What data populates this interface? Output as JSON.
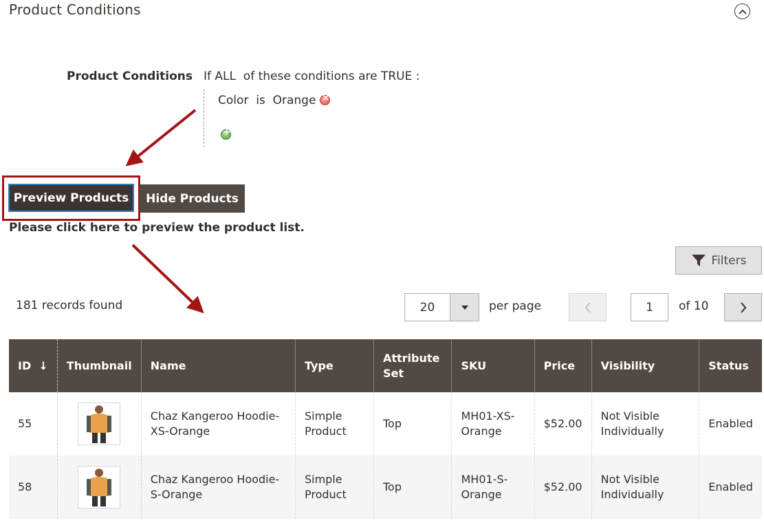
{
  "section": {
    "title": "Product Conditions"
  },
  "conditions": {
    "label": "Product Conditions",
    "rule": {
      "prefix": "If",
      "aggregator": "ALL",
      "middle": "of these conditions are",
      "value": "TRUE",
      "suffix": ":"
    },
    "condition": {
      "attribute": "Color",
      "operator": "is",
      "value": "Orange"
    }
  },
  "buttons": {
    "preview": "Preview Products",
    "hide": "Hide Products"
  },
  "hint": "Please click here to preview the product list.",
  "toolbar": {
    "filters_label": "Filters",
    "records_found": "181 records found",
    "per_page_value": "20",
    "per_page_label": "per page",
    "current_page": "1",
    "of_pages": "of 10"
  },
  "grid": {
    "columns": [
      "ID",
      "Thumbnail",
      "Name",
      "Type",
      "Attribute Set",
      "SKU",
      "Price",
      "Visibility",
      "Status"
    ],
    "sort_indicator": "↓",
    "rows": [
      {
        "id": "55",
        "name": "Chaz Kangeroo Hoodie-XS-Orange",
        "type": "Simple Product",
        "attribute_set": "Top",
        "sku": "MH01-XS-Orange",
        "price": "$52.00",
        "visibility": "Not Visible Individually",
        "status": "Enabled"
      },
      {
        "id": "58",
        "name": "Chaz Kangeroo Hoodie-S-Orange",
        "type": "Simple Product",
        "attribute_set": "Top",
        "sku": "MH01-S-Orange",
        "price": "$52.00",
        "visibility": "Not Visible Individually",
        "status": "Enabled"
      }
    ]
  },
  "colors": {
    "header_bg": "#514943",
    "button_dark": "#514943",
    "highlight_red": "#a31515",
    "focus_blue": "#2f7fb5"
  },
  "icons": [
    "chevron-up-icon",
    "remove-icon",
    "add-icon",
    "funnel-icon",
    "caret-down-icon",
    "chevron-left-icon",
    "chevron-right-icon",
    "product-thumbnail"
  ]
}
